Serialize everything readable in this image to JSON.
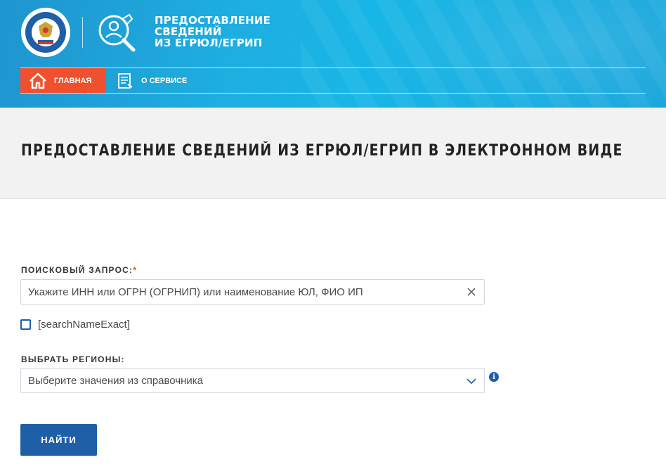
{
  "header": {
    "emblem_name": "fns-emblem",
    "service_title_lines": [
      "ПРЕДОСТАВЛЕНИЕ",
      "СВЕДЕНИЙ",
      "ИЗ ЕГРЮЛ/ЕГРИП"
    ],
    "nav": [
      {
        "label": "ГЛАВНАЯ",
        "icon": "home-icon",
        "active": true
      },
      {
        "label": "О СЕРВИСЕ",
        "icon": "document-icon",
        "active": false
      }
    ]
  },
  "page": {
    "title": "ПРЕДОСТАВЛЕНИЕ СВЕДЕНИЙ ИЗ ЕГРЮЛ/ЕГРИП В ЭЛЕКТРОННОМ ВИДЕ"
  },
  "form": {
    "search_label": "ПОИСКОВЫЙ ЗАПРОС:",
    "required_mark": "*",
    "search_placeholder": "Укажите ИНН или ОГРН (ОГРНИП) или наименование ЮЛ, ФИО ИП",
    "search_value": "",
    "exact_checkbox_label": "[searchNameExact]",
    "exact_checked": false,
    "regions_label": "ВЫБРАТЬ РЕГИОНЫ:",
    "regions_placeholder": "Выберите значения из справочника",
    "info_glyph": "i",
    "submit_label": "НАЙТИ"
  },
  "colors": {
    "header_blue": "#1eaee0",
    "nav_active": "#f0502d",
    "primary": "#1f5fa8",
    "required": "#e8452b"
  }
}
